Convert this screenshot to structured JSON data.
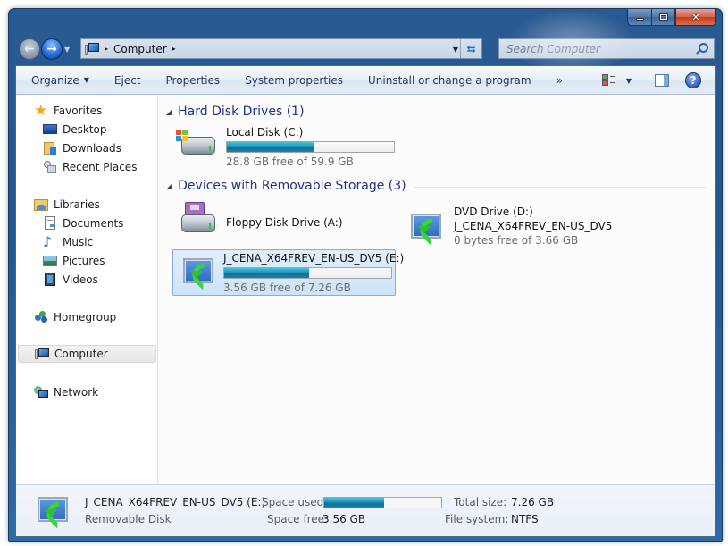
{
  "window": {
    "caption_buttons": {
      "minimize": "minimize",
      "maximize": "maximize",
      "close": "x"
    }
  },
  "nav": {
    "back_icon": "back-arrow",
    "forward_icon": "forward-arrow",
    "address": {
      "breadcrumbs": [
        "Computer"
      ],
      "separator": "▸"
    },
    "search": {
      "placeholder": "Search Computer",
      "value": ""
    }
  },
  "toolbar": {
    "items": [
      {
        "label": "Organize",
        "has_dropdown": true
      },
      {
        "label": "Eject"
      },
      {
        "label": "Properties"
      },
      {
        "label": "System properties"
      },
      {
        "label": "Uninstall or change a program"
      }
    ],
    "overflow_label": "»",
    "help_label": "?"
  },
  "sidebar": {
    "favorites": {
      "label": "Favorites",
      "items": [
        "Desktop",
        "Downloads",
        "Recent Places"
      ]
    },
    "libraries": {
      "label": "Libraries",
      "items": [
        "Documents",
        "Music",
        "Pictures",
        "Videos"
      ]
    },
    "homegroup": {
      "label": "Homegroup"
    },
    "computer": {
      "label": "Computer",
      "selected": true
    },
    "network": {
      "label": "Network"
    }
  },
  "content": {
    "groups": [
      {
        "title": "Hard Disk Drives (1)",
        "drives": [
          {
            "name": "Local Disk (C:)",
            "free_text": "28.8 GB free of 59.9 GB",
            "used_fraction": 0.519
          }
        ]
      },
      {
        "title": "Devices with Removable Storage (3)",
        "drives": [
          {
            "name": "Floppy Disk Drive (A:)"
          },
          {
            "name": "DVD Drive (D:)",
            "label": "J_CENA_X64FREV_EN-US_DV5",
            "free_text": "0 bytes free of 3.66 GB"
          },
          {
            "name": "J_CENA_X64FREV_EN-US_DV5 (E:)",
            "free_text": "3.56 GB free of 7.26 GB",
            "used_fraction": 0.51,
            "selected": true
          }
        ]
      }
    ]
  },
  "details": {
    "name": "J_CENA_X64FREV_EN-US_DV5 (E:)",
    "type": "Removable Disk",
    "space_used_label": "Space used:",
    "space_used_fraction": 0.51,
    "space_free_label": "Space free:",
    "space_free_value": "3.56 GB",
    "total_size_label": "Total size:",
    "total_size_value": "7.26 GB",
    "file_system_label": "File system:",
    "file_system_value": "NTFS"
  }
}
